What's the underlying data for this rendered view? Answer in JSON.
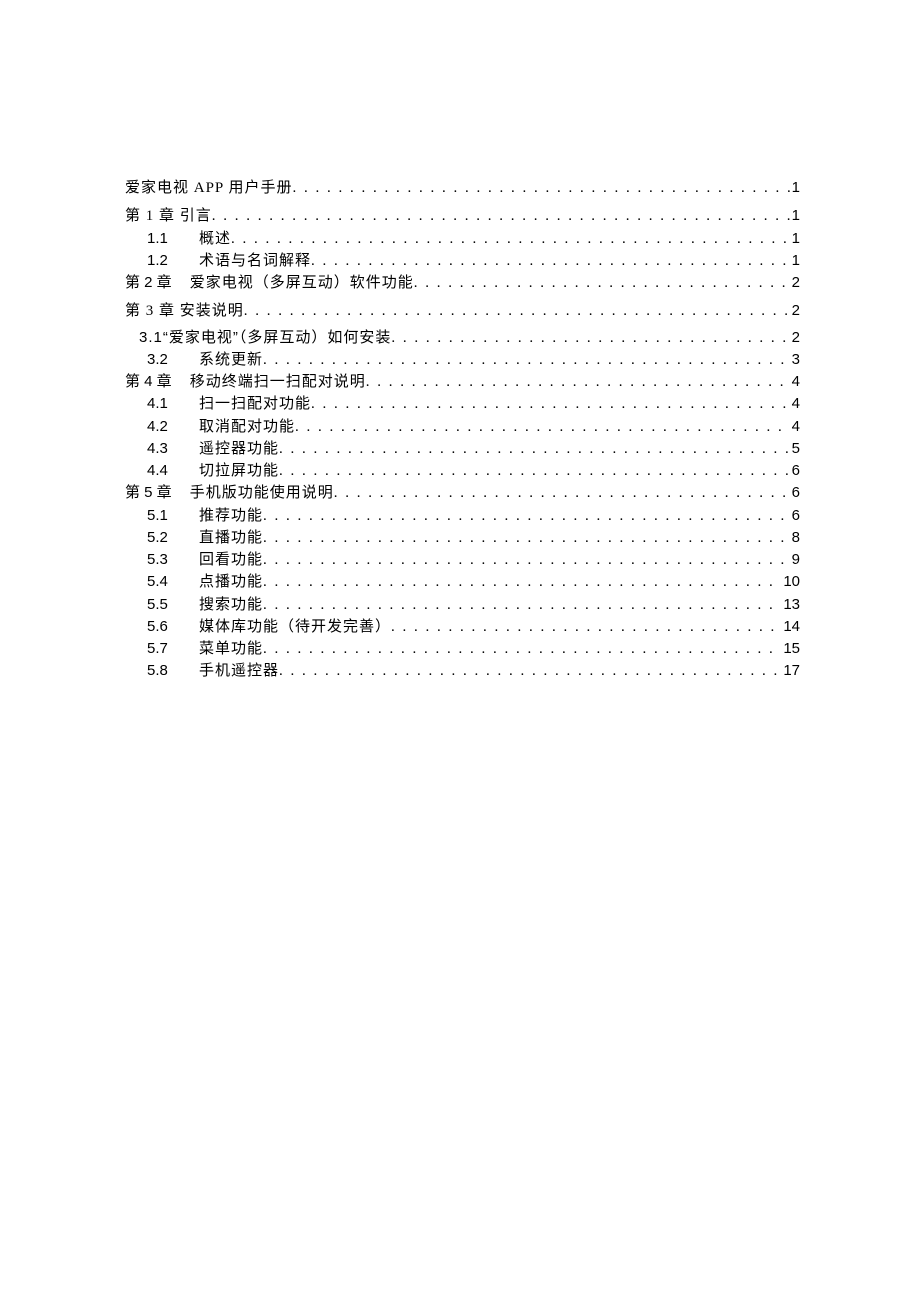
{
  "toc": [
    {
      "level": "lvl0",
      "num": "",
      "title": "爱家电视 APP 用户手册",
      "page": "1",
      "titleClass": ""
    },
    {
      "level": "lvl0",
      "num": "",
      "title": "第 1 章 引言",
      "page": "1",
      "titleClass": ""
    },
    {
      "level": "lvl2",
      "num": "1.1",
      "title": "概述",
      "page": "1",
      "titleClass": ""
    },
    {
      "level": "lvl2",
      "num": "1.2",
      "title": "术语与名词解释",
      "page": "1",
      "titleClass": ""
    },
    {
      "level": "lvl1-inline",
      "num": "第 2 章",
      "title": "爱家电视（多屏互动）软件功能",
      "page": "2",
      "titleClass": ""
    },
    {
      "level": "lvl0",
      "num": "",
      "title": "第 3 章 安装说明",
      "page": "2",
      "titleClass": ""
    },
    {
      "level": "lvl2-special",
      "num": "",
      "title": "3.1“爱家电视”（多屏互动）如何安装",
      "page": "2",
      "titleClass": "sans"
    },
    {
      "level": "lvl2",
      "num": "3.2",
      "title": "系统更新",
      "page": "3",
      "titleClass": ""
    },
    {
      "level": "lvl1-inline",
      "num": "第 4 章",
      "title": "移动终端扫一扫配对说明",
      "page": "4",
      "titleClass": ""
    },
    {
      "level": "lvl2",
      "num": "4.1",
      "title": "扫一扫配对功能",
      "page": "4",
      "titleClass": ""
    },
    {
      "level": "lvl2",
      "num": "4.2",
      "title": "取消配对功能",
      "page": "4",
      "titleClass": ""
    },
    {
      "level": "lvl2",
      "num": "4.3",
      "title": "遥控器功能",
      "page": "5",
      "titleClass": ""
    },
    {
      "level": "lvl2",
      "num": "4.4",
      "title": "切拉屏功能",
      "page": "6",
      "titleClass": ""
    },
    {
      "level": "lvl1-inline",
      "num": "第 5 章",
      "title": "手机版功能使用说明",
      "page": "6",
      "titleClass": ""
    },
    {
      "level": "lvl2",
      "num": "5.1",
      "title": "推荐功能",
      "page": "6",
      "titleClass": ""
    },
    {
      "level": "lvl2",
      "num": "5.2",
      "title": "直播功能",
      "page": "8",
      "titleClass": ""
    },
    {
      "level": "lvl2",
      "num": "5.3",
      "title": "回看功能",
      "page": "9",
      "titleClass": ""
    },
    {
      "level": "lvl2",
      "num": "5.4",
      "title": "点播功能",
      "page": "10",
      "titleClass": ""
    },
    {
      "level": "lvl2",
      "num": "5.5",
      "title": "搜索功能",
      "page": "13",
      "titleClass": ""
    },
    {
      "level": "lvl2",
      "num": "5.6",
      "title": "媒体库功能（待开发完善）",
      "page": "14",
      "titleClass": ""
    },
    {
      "level": "lvl2",
      "num": "5.7",
      "title": "菜单功能",
      "page": "15",
      "titleClass": ""
    },
    {
      "level": "lvl2",
      "num": "5.8",
      "title": "手机遥控器",
      "page": "17",
      "titleClass": ""
    }
  ]
}
